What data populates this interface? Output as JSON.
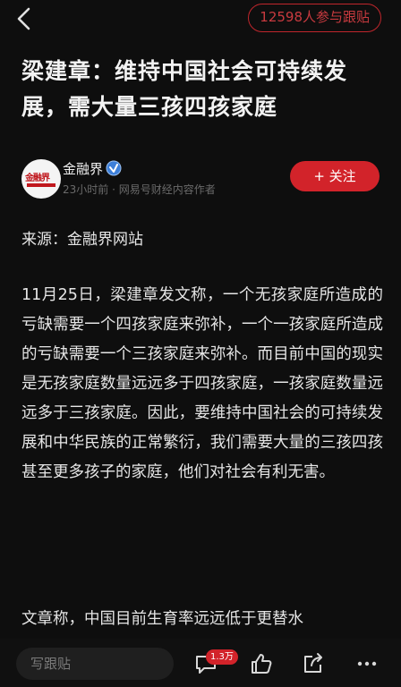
{
  "header": {
    "back_icon": "chevron-left-icon",
    "follow_count": "12598人参与跟贴"
  },
  "article": {
    "title": "梁建章：维持中国社会可持续发展，需大量三孩四孩家庭",
    "author": {
      "name": "金融界",
      "avatar_text": "金融界",
      "meta": "23小时前 · 网易号财经内容作者",
      "follow_label": "+ 关注"
    },
    "source": "来源：金融界网站",
    "paragraphs": [
      "11月25日，梁建章发文称，一个无孩家庭所造成的亏缺需要一个四孩家庭来弥补，一个一孩家庭所造成的亏缺需要一个三孩家庭来弥补。而目前中国的现实是无孩家庭数量远远多于四孩家庭，一孩家庭数量远远多于三孩家庭。因此，要维持中国社会的可持续发展和中华民族的正常繁衍，我们需要大量的三孩四孩甚至更多孩子的家庭，他们对社会有利无害。",
      "文章称，中国目前生育率远远低于更替水"
    ]
  },
  "bottom_bar": {
    "comment_placeholder": "写跟贴",
    "comment_badge": "1.3万"
  },
  "colors": {
    "accent": "#d2232a",
    "background": "#0e0e0e"
  }
}
